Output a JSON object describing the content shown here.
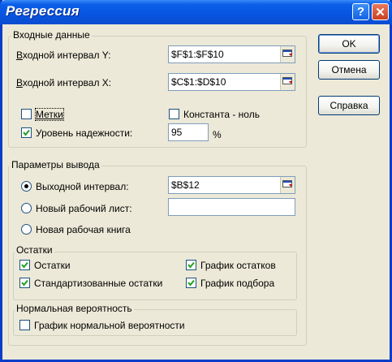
{
  "window": {
    "title": "Регрессия",
    "help_glyph": "?",
    "close_glyph": "✕"
  },
  "input_group": {
    "title": "Входные данные",
    "y_range_label": "Входной интервал Y:",
    "y_range_value": "$F$1:$F$10",
    "x_range_label": "Входной интервал X:",
    "x_range_value": "$C$1:$D$10",
    "labels_checkbox": {
      "label": "Метки",
      "checked": false
    },
    "constant_zero_checkbox": {
      "label": "Константа - ноль",
      "checked": false
    },
    "confidence_checkbox": {
      "label": "Уровень надежности:",
      "checked": true
    },
    "confidence_value": "95",
    "percent_sign": "%"
  },
  "output_group": {
    "title": "Параметры вывода",
    "output_range_radio": {
      "label": "Выходной интервал:",
      "selected": true
    },
    "output_range_value": "$B$12",
    "new_sheet_radio": {
      "label": "Новый рабочий лист:",
      "selected": false
    },
    "new_sheet_value": "",
    "new_workbook_radio": {
      "label": "Новая рабочая книга",
      "selected": false
    }
  },
  "residuals_group": {
    "title": "Остатки",
    "residuals": {
      "label": "Остатки",
      "checked": true
    },
    "standardized_residuals": {
      "label": "Стандартизованные остатки",
      "checked": true
    },
    "residual_plots": {
      "label": "График остатков",
      "checked": true
    },
    "line_fit_plots": {
      "label": "График подбора",
      "checked": true
    }
  },
  "normal_prob_group": {
    "title": "Нормальная вероятность",
    "normal_prob_plot": {
      "label": "График нормальной вероятности",
      "checked": false
    }
  },
  "buttons": {
    "ok": "OK",
    "cancel": "Отмена",
    "help": "Справка"
  },
  "colors": {
    "title_bar": "#0754E0",
    "dialog_bg": "#ECE9D8",
    "field_border": "#7F9DB9"
  }
}
